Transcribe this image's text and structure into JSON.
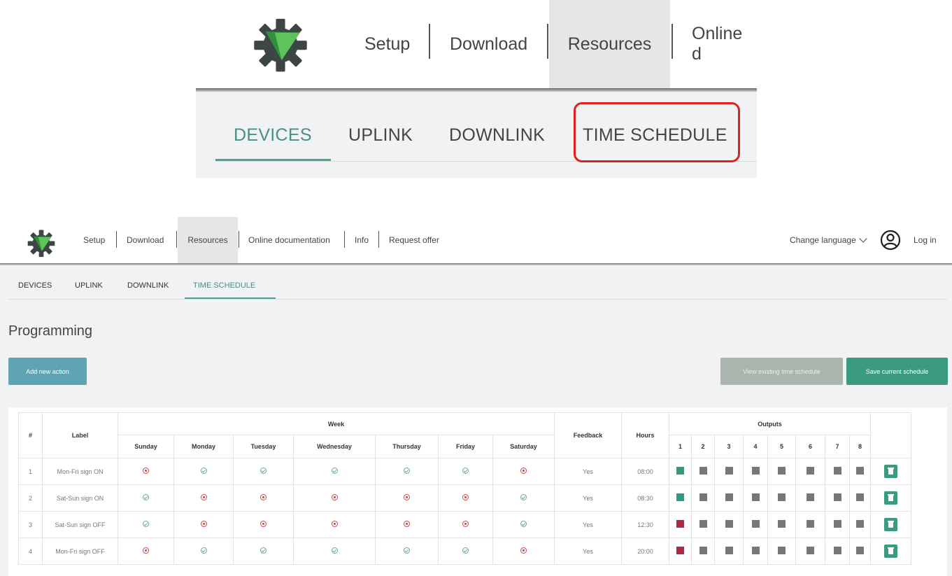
{
  "colors": {
    "accent": "#4aa38e",
    "primary_button": "#3a9b80",
    "info_button": "#5fa4b2",
    "disabled_button": "#a9b5ad",
    "highlight": "#e0201c",
    "output_on_green": "#2e9a80",
    "output_on_red": "#b3283a",
    "output_off": "#777777",
    "check_yes": "#6aaa90",
    "check_no": "#c94747"
  },
  "icons": {
    "logo": "gear-logo-icon",
    "user": "user-circle-icon",
    "language": "chevron-down-icon",
    "delete": "trash-icon",
    "yes": "check-circle-icon",
    "no": "x-circle-icon"
  },
  "zoom": {
    "nav": [
      "Setup",
      "Download",
      "Resources",
      "Online d"
    ],
    "subnav": [
      "DEVICES",
      "UPLINK",
      "DOWNLINK",
      "TIME SCHEDULE"
    ]
  },
  "nav": {
    "items": [
      "Setup",
      "Download",
      "Resources",
      "Online documentation",
      "Info",
      "Request offer"
    ],
    "active": "Resources",
    "change_language": "Change language",
    "login": "Log in"
  },
  "subnav": {
    "items": [
      "DEVICES",
      "UPLINK",
      "DOWNLINK",
      "TIME SCHEDULE"
    ],
    "active": "TIME SCHEDULE"
  },
  "page": {
    "title": "Programming",
    "add_button": "Add new action",
    "view_button": "View existing time schedule",
    "save_button": "Save current schedule"
  },
  "table": {
    "headers": {
      "index": "#",
      "label": "Label",
      "week": "Week",
      "feedback": "Feedback",
      "hours": "Hours",
      "outputs": "Outputs"
    },
    "days": [
      "Sunday",
      "Monday",
      "Tuesday",
      "Wednesday",
      "Thursday",
      "Friday",
      "Saturday"
    ],
    "outputs": [
      "1",
      "2",
      "3",
      "4",
      "5",
      "6",
      "7",
      "8"
    ],
    "rows": [
      {
        "index": "1",
        "label": "Mon-Fri sign ON",
        "days": [
          false,
          true,
          true,
          true,
          true,
          true,
          false
        ],
        "feedback": "Yes",
        "hours": "08:00",
        "output1": "on-green"
      },
      {
        "index": "2",
        "label": "Sat-Sun sign ON",
        "days": [
          true,
          false,
          false,
          false,
          false,
          false,
          true
        ],
        "feedback": "Yes",
        "hours": "08:30",
        "output1": "on-green"
      },
      {
        "index": "3",
        "label": "Sat-Sun sign OFF",
        "days": [
          true,
          false,
          false,
          false,
          false,
          false,
          true
        ],
        "feedback": "Yes",
        "hours": "12:30",
        "output1": "on-red"
      },
      {
        "index": "4",
        "label": "Mon-Fri sign OFF",
        "days": [
          false,
          true,
          true,
          true,
          true,
          true,
          false
        ],
        "feedback": "Yes",
        "hours": "20:00",
        "output1": "on-red"
      }
    ]
  }
}
